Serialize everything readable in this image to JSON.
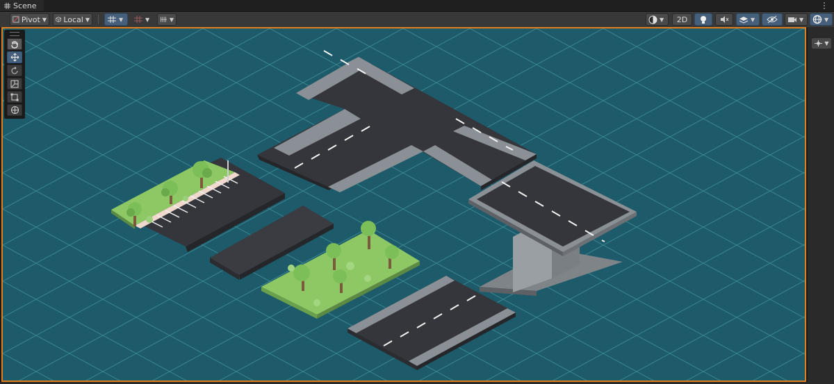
{
  "window": {
    "tab_title": "Scene",
    "more_icon": "kebab-menu-icon"
  },
  "toolbar": {
    "pivot_label": "Pivot",
    "local_label": "Local",
    "mode_2d_label": "2D",
    "buttons": [
      "transform-pivot",
      "transform-space",
      "grid-snapping",
      "increment-snap",
      "draw-grid",
      "draw-mode",
      "2d-toggle",
      "lighting",
      "audio",
      "effects",
      "hidden-objects",
      "camera",
      "gizmos"
    ]
  },
  "tools": [
    "view-tool",
    "move-tool",
    "rotate-tool",
    "scale-tool",
    "rect-tool",
    "transform-tool"
  ],
  "active_tool": "move-tool",
  "colors": {
    "ground": "#1d5b6a",
    "grid": "#3f8a96",
    "road": "#34363c",
    "road_side": "#24262a",
    "sidewalk": "#8b9096",
    "grass": "#8dc865",
    "selection_outline": "#e07f1c",
    "active_button": "#46607c"
  }
}
